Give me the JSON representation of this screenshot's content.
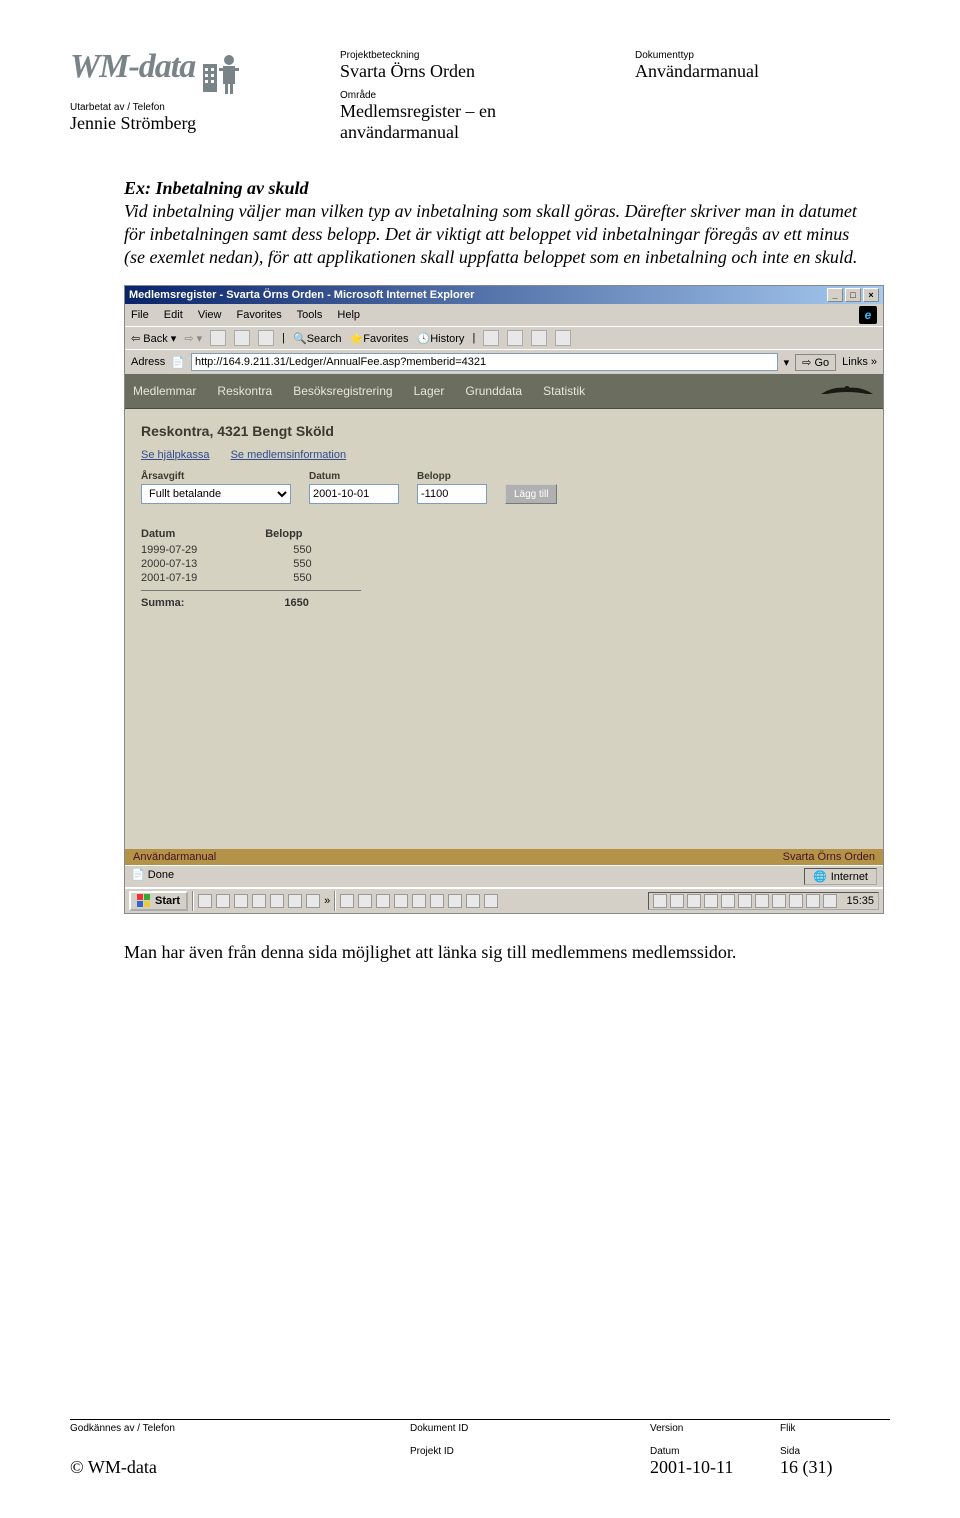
{
  "header": {
    "logo_text": "WM-data",
    "projekt_label": "Projektbeteckning",
    "projekt_value": "Svarta Örns Orden",
    "doktype_label": "Dokumenttyp",
    "doktype_value": "Användarmanual",
    "utarbetat_label": "Utarbetat av / Telefon",
    "utarbetat_value": "Jennie Strömberg",
    "omrade_label": "Område",
    "omrade_value": "Medlemsregister – en användarmanual"
  },
  "body": {
    "title": "Ex: Inbetalning av skuld",
    "para": "Vid inbetalning väljer man vilken typ av inbetalning som skall göras. Därefter skriver man in datumet för inbetalningen samt dess belopp. Det är viktigt att beloppet vid inbetalningar föregås av ett minus (se exemlet nedan), för att applikationen skall uppfatta beloppet som en inbetalning och inte en skuld.",
    "after": "Man har även från denna sida möjlighet att länka sig till medlemmens medlemssidor."
  },
  "screenshot": {
    "window_title": "Medlemsregister - Svarta Örns Orden - Microsoft Internet Explorer",
    "menu": [
      "File",
      "Edit",
      "View",
      "Favorites",
      "Tools",
      "Help"
    ],
    "toolbar_back": "Back",
    "toolbar_search": "Search",
    "toolbar_favorites": "Favorites",
    "toolbar_history": "History",
    "address_label": "Adress",
    "address_url": "http://164.9.211.31/Ledger/AnnualFee.asp?memberid=4321",
    "go_label": "Go",
    "links_label": "Links »",
    "nav_tabs": [
      "Medlemmar",
      "Reskontra",
      "Besöksregistrering",
      "Lager",
      "Grunddata",
      "Statistik"
    ],
    "content_title": "Reskontra, 4321 Bengt Sköld",
    "links": [
      "Se hjälpkassa",
      "Se medlemsinformation"
    ],
    "form": {
      "arsavgift_label": "Årsavgift",
      "arsavgift_value": "Fullt betalande",
      "datum_label": "Datum",
      "datum_value": "2001-10-01",
      "belopp_label": "Belopp",
      "belopp_value": "-1100",
      "add_btn": "Lägg till"
    },
    "ledger": {
      "head_date": "Datum",
      "head_amount": "Belopp",
      "rows": [
        {
          "date": "1999-07-29",
          "amount": "550"
        },
        {
          "date": "2000-07-13",
          "amount": "550"
        },
        {
          "date": "2001-07-19",
          "amount": "550"
        }
      ],
      "sum_label": "Summa:",
      "sum_value": "1650"
    },
    "app_footer_left": "Användarmanual",
    "app_footer_right": "Svarta Örns Orden",
    "status_done": "Done",
    "status_zone": "Internet",
    "taskbar": {
      "start": "Start",
      "time": "15:35"
    }
  },
  "footer": {
    "godk_label": "Godkännes av / Telefon",
    "dokid_label": "Dokument ID",
    "version_label": "Version",
    "flik_label": "Flik",
    "copyright": "© WM-data",
    "projektid_label": "Projekt ID",
    "datum_label": "Datum",
    "datum_value": "2001-10-11",
    "sida_label": "Sida",
    "sida_value": "16 (31)"
  }
}
